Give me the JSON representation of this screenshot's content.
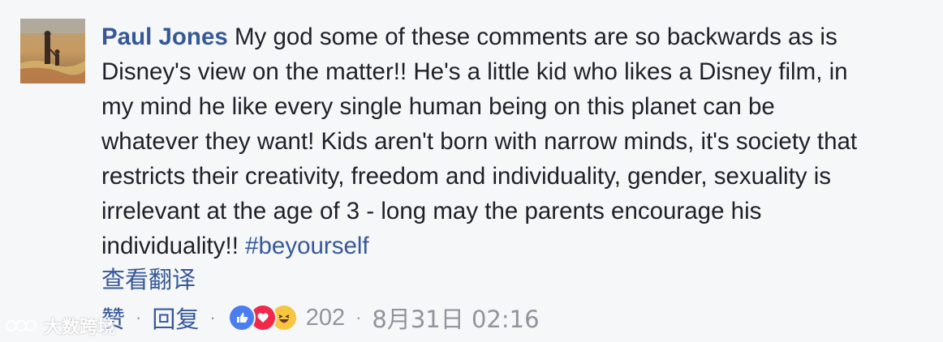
{
  "comment": {
    "author": "Paul Jones",
    "text_lines": [
      "My god some of these comments are so backwards as is",
      "Disney's view on the matter!! He's a little kid who likes a Disney film, in",
      "my mind he like every single human being on this planet can be",
      "whatever they want! Kids aren't born with narrow minds, it's society that",
      "restricts their creativity, freedom and individuality, gender, sexuality is",
      "irrelevant at the age of 3 - long may the parents encourage his",
      "individuality!! "
    ],
    "hashtag": "#beyourself",
    "translate_label": "查看翻译",
    "like_label": "赞",
    "reply_label": "回复",
    "separator": "·",
    "reactions": [
      "like-icon",
      "love-icon",
      "haha-icon"
    ],
    "reaction_count": "202",
    "timestamp": "8月31日 02:16"
  },
  "watermark": {
    "text": "大数跨境"
  },
  "colors": {
    "link": "#365899",
    "text": "#1d2129",
    "meta": "#90949c",
    "background": "#f6f7f9"
  }
}
